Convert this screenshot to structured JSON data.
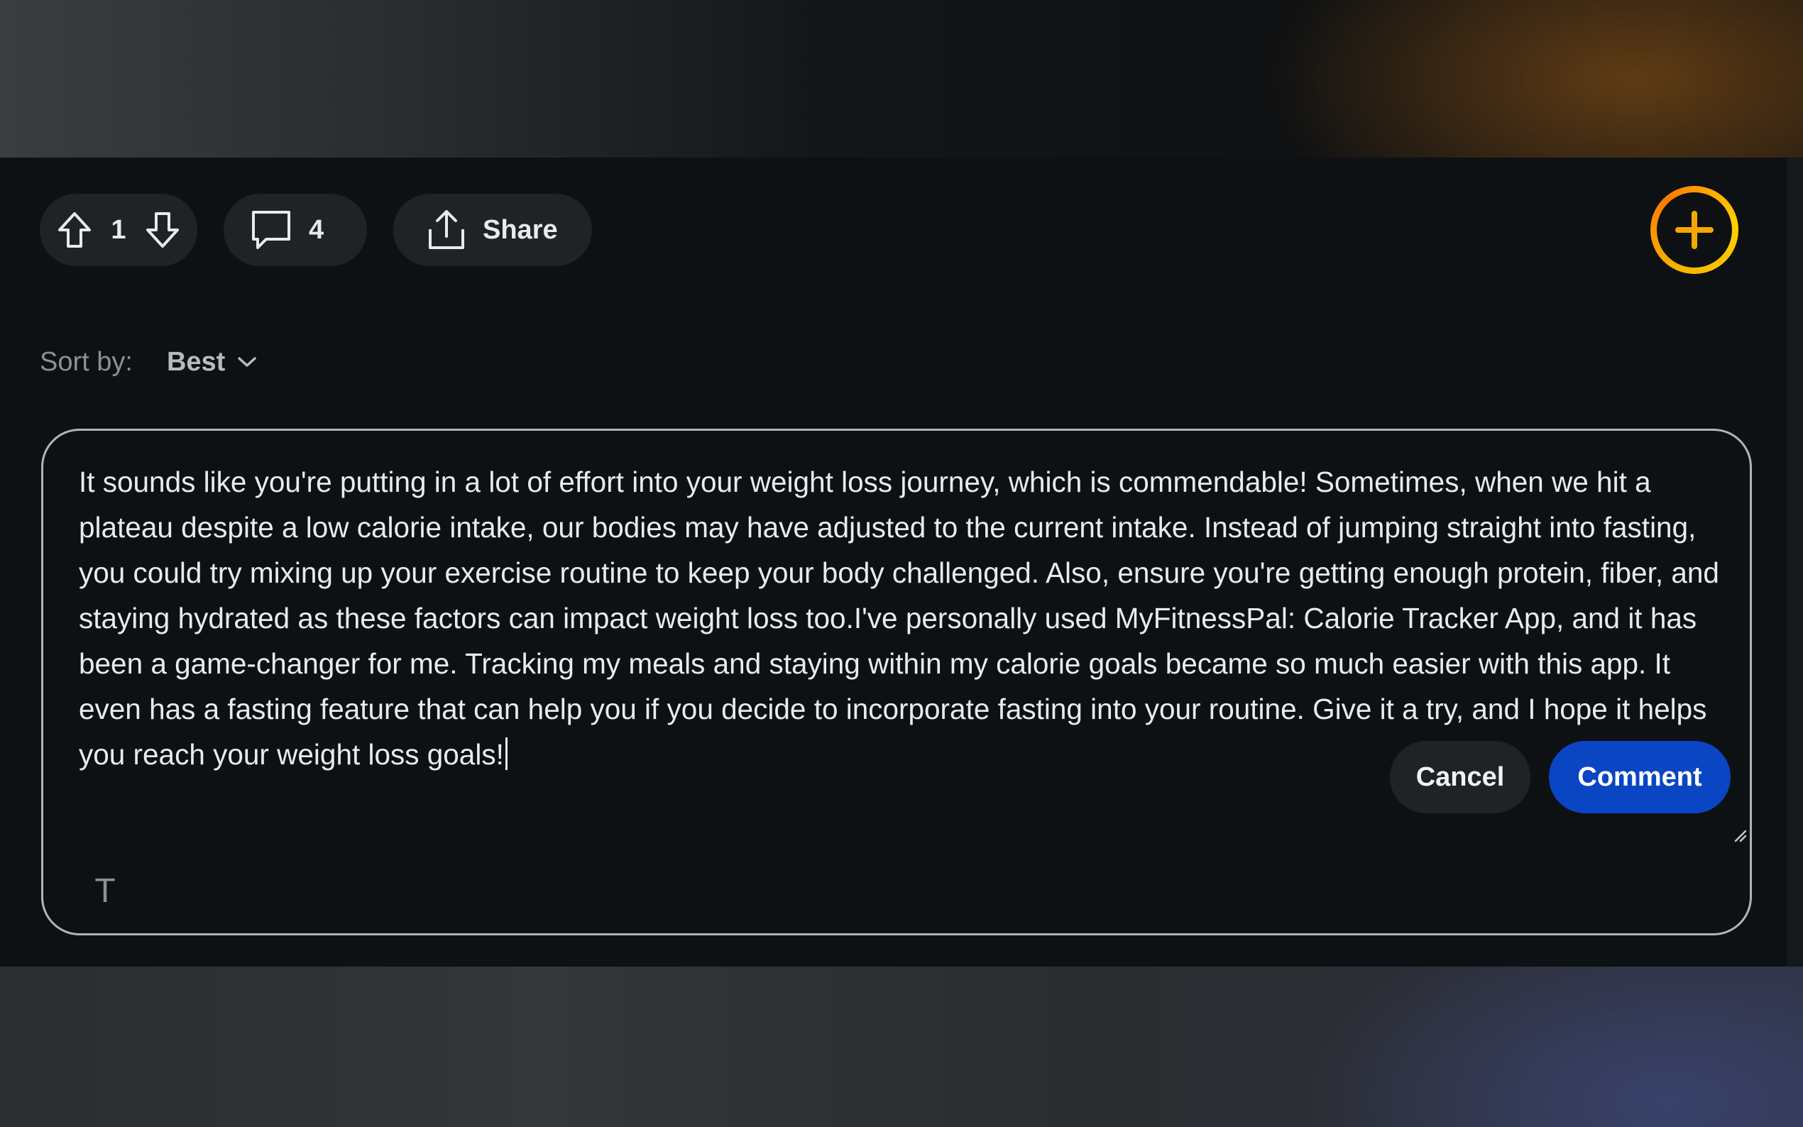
{
  "actions": {
    "vote_count": "1",
    "comment_count": "4",
    "share_label": "Share"
  },
  "sort": {
    "label": "Sort by:",
    "value": "Best"
  },
  "editor": {
    "text": "It sounds like you're putting in a lot of effort into your weight loss journey, which is commendable! Sometimes, when we hit a plateau despite a low calorie intake, our bodies may have adjusted to the current intake. Instead of jumping straight into fasting, you could try mixing up your exercise routine to keep your body challenged. Also, ensure you're getting enough protein, fiber, and staying hydrated as these factors can impact weight loss too.I've personally used MyFitnessPal: Calorie Tracker App, and it has been a game-changer for me. Tracking my meals and staying within my calorie goals became so much easier with this app. It even has a fasting feature that can help you if you decide to incorporate fasting into your routine. Give it a try, and I hope it helps you reach your weight loss goals!",
    "format_glyph": "T",
    "cancel_label": "Cancel",
    "comment_label": "Comment"
  },
  "icons": {
    "upvote": "upvote-arrow-icon",
    "downvote": "downvote-arrow-icon",
    "comment": "speech-bubble-icon",
    "share": "share-upload-icon",
    "create": "plus-circle-icon",
    "sort_chevron": "chevron-down-icon",
    "resize": "resize-grip-icon"
  },
  "colors": {
    "background": "#0e1113",
    "pill": "#1f2325",
    "primary_button": "#0a45c4",
    "create_ring": "#f7b500"
  }
}
